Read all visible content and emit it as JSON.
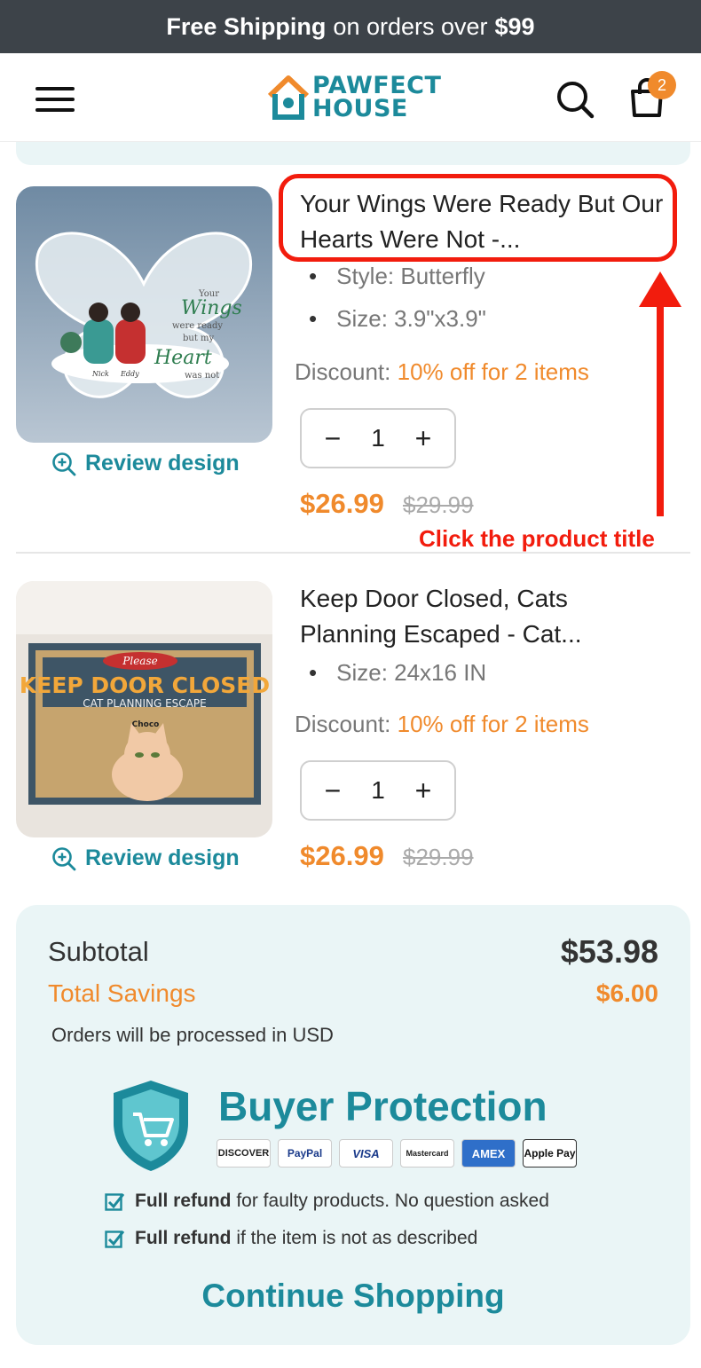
{
  "promo": {
    "prefix": "Free Shipping",
    "middle": "on orders over",
    "amount": "$99"
  },
  "header": {
    "logo_line1": "PAWFECT",
    "logo_line2": "HOUSE",
    "cart_count": "2"
  },
  "items": [
    {
      "title": "Your Wings Were Ready But Our Hearts Were Not -...",
      "specs": [
        "Style: Butterfly",
        "Size: 3.9\"x3.9\""
      ],
      "discount_label": "Discount:",
      "discount_value": "10% off for 2 items",
      "quantity": "1",
      "price": "$26.99",
      "old_price": "$29.99",
      "review_label": "Review design",
      "image_text": {
        "line1": "Your",
        "line2": "Wings",
        "line3": "were ready",
        "line4": "but my",
        "line5": "Heart",
        "line6": "was not",
        "name1": "Nick",
        "name2": "Eddy"
      }
    },
    {
      "title": "Keep Door Closed, Cats Planning Escaped - Cat...",
      "specs": [
        "Size: 24x16 IN"
      ],
      "discount_label": "Discount:",
      "discount_value": "10% off for 2 items",
      "quantity": "1",
      "price": "$26.99",
      "old_price": "$29.99",
      "review_label": "Review design",
      "image_text": {
        "please": "Please",
        "headline": "KEEP DOOR CLOSED",
        "subline": "CAT PLANNING ESCAPE",
        "name": "Choco"
      }
    }
  ],
  "qty_controls": {
    "minus": "−",
    "plus": "+"
  },
  "annotation": {
    "text": "Click the product title"
  },
  "summary": {
    "subtotal_label": "Subtotal",
    "subtotal_value": "$53.98",
    "savings_label": "Total Savings",
    "savings_value": "$6.00",
    "currency_note": "Orders will be processed in USD",
    "protection_title": "Buyer Protection",
    "payment_methods": [
      "DISCOVER",
      "PayPal",
      "VISA",
      "Mastercard",
      "AMEX",
      "Apple Pay"
    ],
    "guarantees": [
      {
        "bold": "Full refund",
        "rest": "for faulty products. No question asked"
      },
      {
        "bold": "Full refund",
        "rest": "if the item is not as described"
      }
    ],
    "continue_label": "Continue Shopping"
  },
  "colors": {
    "accent": "#1c8a9b",
    "orange": "#f08a2c",
    "annotation_red": "#f21c0d",
    "promo_bg": "#3d4349",
    "summary_bg": "#eaf5f6"
  }
}
